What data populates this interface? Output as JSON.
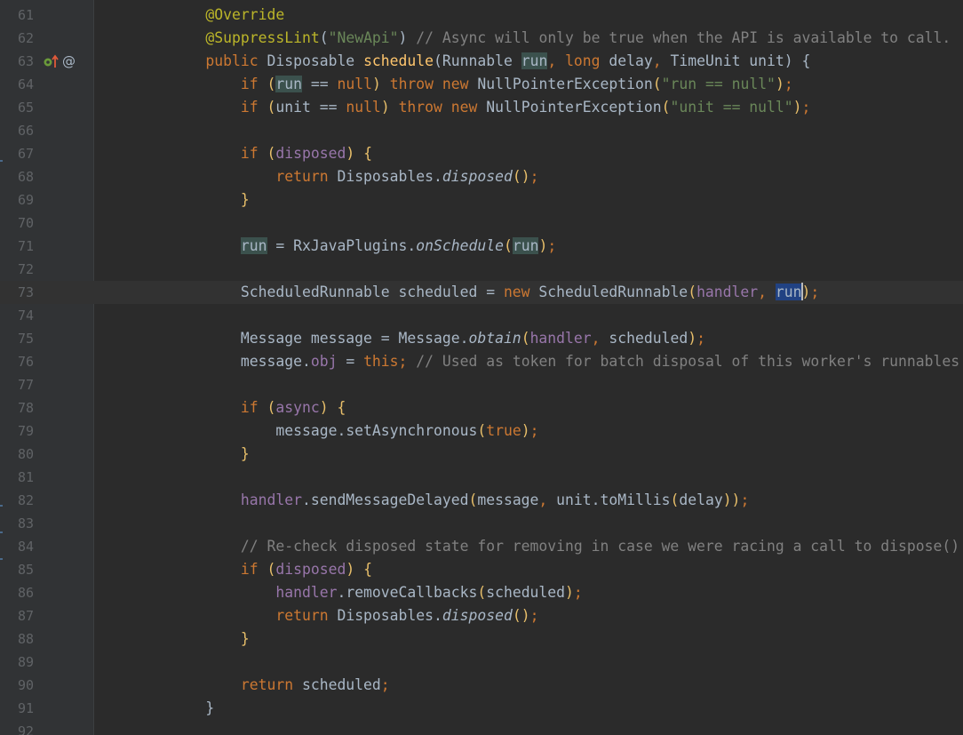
{
  "editor": {
    "colors": {
      "background": "#2b2b2b",
      "gutter": "#313335",
      "line_number": "#606366",
      "keyword": "#cc7832",
      "annotation": "#bbb529",
      "string": "#6a8759",
      "comment": "#808080",
      "method": "#ffc66d",
      "field": "#9876aa",
      "plain": "#a9b7c6",
      "selection": "#214283"
    },
    "gutter_icons": {
      "line": "63",
      "implements_icon": "implements-interface-icon",
      "annotation_icon": "@"
    },
    "lines": [
      {
        "num": "61",
        "tokens": [
          [
            "            ",
            ""
          ],
          [
            "@Override",
            "an"
          ]
        ]
      },
      {
        "num": "62",
        "tokens": [
          [
            "            ",
            ""
          ],
          [
            "@SuppressLint",
            "an"
          ],
          [
            "(",
            ""
          ],
          [
            "\"NewApi\"",
            "st"
          ],
          [
            ") ",
            ""
          ],
          [
            "// Async will only be true when the API is available to call.",
            "cm"
          ]
        ]
      },
      {
        "num": "63",
        "tokens": [
          [
            "            ",
            ""
          ],
          [
            "public ",
            "kw"
          ],
          [
            "Disposable ",
            ""
          ],
          [
            "schedule",
            "fn"
          ],
          [
            "(Runnable ",
            ""
          ],
          [
            "run",
            "dp"
          ],
          [
            ", ",
            "kw"
          ],
          [
            "long ",
            "kw"
          ],
          [
            "delay",
            ""
          ],
          [
            ", ",
            "kw"
          ],
          [
            "TimeUnit unit) {",
            ""
          ]
        ]
      },
      {
        "num": "64",
        "tokens": [
          [
            "                ",
            ""
          ],
          [
            "if ",
            "kw"
          ],
          [
            "(",
            "par"
          ],
          [
            "run",
            "dp"
          ],
          [
            " == ",
            ""
          ],
          [
            "null",
            "kw"
          ],
          [
            ") ",
            "par"
          ],
          [
            "throw new ",
            "kw"
          ],
          [
            "NullPointerException",
            ""
          ],
          [
            "(",
            "par"
          ],
          [
            "\"run == null\"",
            "st"
          ],
          [
            ")",
            "par"
          ],
          [
            ";",
            "kw"
          ]
        ]
      },
      {
        "num": "65",
        "tokens": [
          [
            "                ",
            ""
          ],
          [
            "if ",
            "kw"
          ],
          [
            "(",
            "par"
          ],
          [
            "unit == ",
            ""
          ],
          [
            "null",
            "kw"
          ],
          [
            ") ",
            "par"
          ],
          [
            "throw new ",
            "kw"
          ],
          [
            "NullPointerException",
            ""
          ],
          [
            "(",
            "par"
          ],
          [
            "\"unit == null\"",
            "st"
          ],
          [
            ")",
            "par"
          ],
          [
            ";",
            "kw"
          ]
        ]
      },
      {
        "num": "66",
        "tokens": []
      },
      {
        "num": "67",
        "tokens": [
          [
            "                ",
            ""
          ],
          [
            "if ",
            "kw"
          ],
          [
            "(",
            "par"
          ],
          [
            "disposed",
            "fd"
          ],
          [
            ") {",
            "par"
          ]
        ]
      },
      {
        "num": "68",
        "tokens": [
          [
            "                    ",
            ""
          ],
          [
            "return ",
            "kw"
          ],
          [
            "Disposables.",
            ""
          ],
          [
            "disposed",
            "it"
          ],
          [
            "()",
            "par"
          ],
          [
            ";",
            "kw"
          ]
        ]
      },
      {
        "num": "69",
        "tokens": [
          [
            "                ",
            ""
          ],
          [
            "}",
            "par"
          ]
        ]
      },
      {
        "num": "70",
        "tokens": []
      },
      {
        "num": "71",
        "tokens": [
          [
            "                ",
            ""
          ],
          [
            "run",
            "dp"
          ],
          [
            " = RxJavaPlugins.",
            ""
          ],
          [
            "onSchedule",
            "it"
          ],
          [
            "(",
            "par"
          ],
          [
            "run",
            "dp"
          ],
          [
            ")",
            "par"
          ],
          [
            ";",
            "kw"
          ]
        ]
      },
      {
        "num": "72",
        "tokens": []
      },
      {
        "num": "73",
        "tokens": [
          [
            "                ",
            ""
          ],
          [
            "ScheduledRunnable scheduled = ",
            ""
          ],
          [
            "new ",
            "kw"
          ],
          [
            "ScheduledRunnable",
            ""
          ],
          [
            "(",
            "par"
          ],
          [
            "handler",
            "fd"
          ],
          [
            ", ",
            "kw"
          ],
          [
            "run",
            "hl"
          ],
          [
            "|",
            "caret"
          ],
          [
            ")",
            "par"
          ],
          [
            ";",
            "kw"
          ]
        ]
      },
      {
        "num": "74",
        "tokens": []
      },
      {
        "num": "75",
        "tokens": [
          [
            "                ",
            ""
          ],
          [
            "Message message = Message.",
            ""
          ],
          [
            "obtain",
            "it"
          ],
          [
            "(",
            "par"
          ],
          [
            "handler",
            "fd"
          ],
          [
            ", ",
            "kw"
          ],
          [
            "scheduled",
            ""
          ],
          [
            ")",
            "par"
          ],
          [
            ";",
            "kw"
          ]
        ]
      },
      {
        "num": "76",
        "tokens": [
          [
            "                ",
            ""
          ],
          [
            "message.",
            ""
          ],
          [
            "obj",
            "fd"
          ],
          [
            " = ",
            ""
          ],
          [
            "this",
            "kw"
          ],
          [
            "; ",
            "kw"
          ],
          [
            "// Used as token for batch disposal of this worker's runnables.",
            "cm"
          ]
        ]
      },
      {
        "num": "77",
        "tokens": []
      },
      {
        "num": "78",
        "tokens": [
          [
            "                ",
            ""
          ],
          [
            "if ",
            "kw"
          ],
          [
            "(",
            "par"
          ],
          [
            "async",
            "fd"
          ],
          [
            ") {",
            "par"
          ]
        ]
      },
      {
        "num": "79",
        "tokens": [
          [
            "                    ",
            ""
          ],
          [
            "message.setAsynchronous",
            ""
          ],
          [
            "(",
            "par"
          ],
          [
            "true",
            "kw"
          ],
          [
            ")",
            "par"
          ],
          [
            ";",
            "kw"
          ]
        ]
      },
      {
        "num": "80",
        "tokens": [
          [
            "                ",
            ""
          ],
          [
            "}",
            "par"
          ]
        ]
      },
      {
        "num": "81",
        "tokens": []
      },
      {
        "num": "82",
        "tokens": [
          [
            "                ",
            ""
          ],
          [
            "handler",
            "fd"
          ],
          [
            ".sendMessageDelayed",
            ""
          ],
          [
            "(",
            "par"
          ],
          [
            "message",
            ""
          ],
          [
            ", ",
            "kw"
          ],
          [
            "unit.toMillis",
            ""
          ],
          [
            "(",
            "par"
          ],
          [
            "delay",
            ""
          ],
          [
            "))",
            "par"
          ],
          [
            ";",
            "kw"
          ]
        ]
      },
      {
        "num": "83",
        "tokens": []
      },
      {
        "num": "84",
        "tokens": [
          [
            "                ",
            ""
          ],
          [
            "// Re-check disposed state for removing in case we were racing a call to dispose().",
            "cm"
          ]
        ]
      },
      {
        "num": "85",
        "tokens": [
          [
            "                ",
            ""
          ],
          [
            "if ",
            "kw"
          ],
          [
            "(",
            "par"
          ],
          [
            "disposed",
            "fd"
          ],
          [
            ") {",
            "par"
          ]
        ]
      },
      {
        "num": "86",
        "tokens": [
          [
            "                    ",
            ""
          ],
          [
            "handler",
            "fd"
          ],
          [
            ".removeCallbacks",
            ""
          ],
          [
            "(",
            "par"
          ],
          [
            "scheduled",
            ""
          ],
          [
            ")",
            "par"
          ],
          [
            ";",
            "kw"
          ]
        ]
      },
      {
        "num": "87",
        "tokens": [
          [
            "                    ",
            ""
          ],
          [
            "return ",
            "kw"
          ],
          [
            "Disposables.",
            ""
          ],
          [
            "disposed",
            "it"
          ],
          [
            "()",
            "par"
          ],
          [
            ";",
            "kw"
          ]
        ]
      },
      {
        "num": "88",
        "tokens": [
          [
            "                ",
            ""
          ],
          [
            "}",
            "par"
          ]
        ]
      },
      {
        "num": "89",
        "tokens": []
      },
      {
        "num": "90",
        "tokens": [
          [
            "                ",
            ""
          ],
          [
            "return ",
            "kw"
          ],
          [
            "scheduled",
            ""
          ],
          [
            ";",
            "kw"
          ]
        ]
      },
      {
        "num": "91",
        "tokens": [
          [
            "            ",
            ""
          ],
          [
            "}",
            ""
          ]
        ]
      },
      {
        "num": "92",
        "tokens": []
      }
    ],
    "current_line": "73"
  }
}
